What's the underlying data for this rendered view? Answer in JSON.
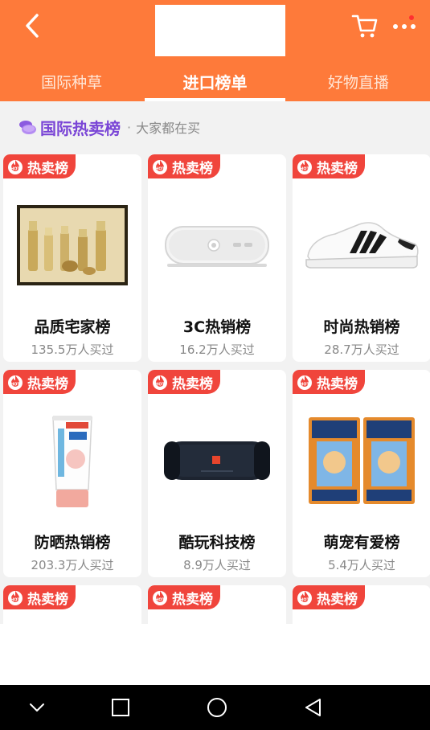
{
  "header": {
    "tabs": [
      {
        "label": "国际种草"
      },
      {
        "label": "进口榜单"
      },
      {
        "label": "好物直播"
      }
    ]
  },
  "section": {
    "title": "国际热卖榜",
    "separator": "·",
    "subtitle": "大家都在买"
  },
  "badge": {
    "icon_text": "HOT",
    "label": "热卖榜"
  },
  "cards": [
    {
      "name": "品质宅家榜",
      "count": "135.5万人买过",
      "image": "skincare-gift-set"
    },
    {
      "name": "3C热销榜",
      "count": "16.2万人买过",
      "image": "white-speaker"
    },
    {
      "name": "时尚热销榜",
      "count": "28.7万人买过",
      "image": "sneaker"
    },
    {
      "name": "防晒热销榜",
      "count": "203.3万人买过",
      "image": "sunscreen-tube"
    },
    {
      "name": "酷玩科技榜",
      "count": "8.9万人买过",
      "image": "bluetooth-speaker"
    },
    {
      "name": "萌宠有爱榜",
      "count": "5.4万人买过",
      "image": "pet-food-bags"
    }
  ],
  "icons": {
    "back": "chevron-left-icon",
    "cart": "cart-icon",
    "more": "more-icon",
    "nav_down": "chevron-down-icon",
    "nav_recents": "square-icon",
    "nav_home": "circle-icon",
    "nav_back": "triangle-back-icon"
  },
  "colors": {
    "header": "#fe7a3a",
    "accent_purple": "#7a45d6",
    "badge": "#f0453c"
  }
}
